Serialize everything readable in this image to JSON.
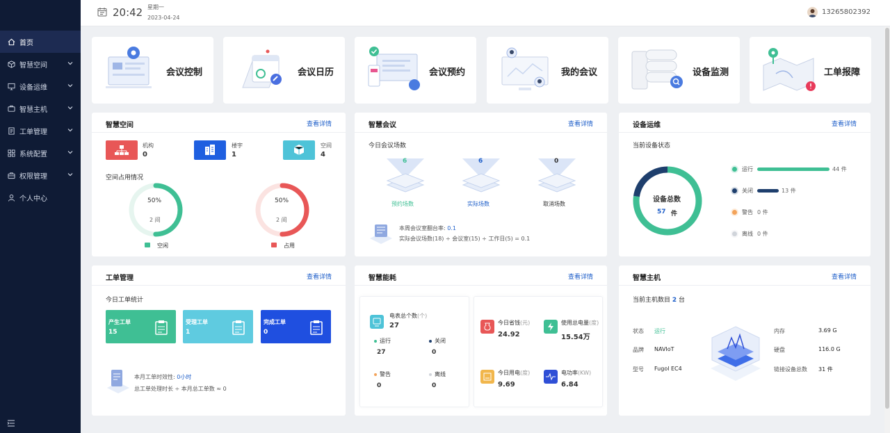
{
  "colors": {
    "sidebar": "#0f1b35",
    "accent": "#1f5fc9",
    "green": "#3fbf94",
    "red": "#e85757",
    "navy": "#1e3f6d",
    "orange": "#f3a35a"
  },
  "header": {
    "time": "20:42",
    "weekday": "星期一",
    "date": "2023-04-24",
    "user": "13265802392"
  },
  "sidebar": {
    "items": [
      {
        "label": "首页",
        "icon": "home-icon"
      },
      {
        "label": "智慧空间",
        "icon": "cube-icon"
      },
      {
        "label": "设备运维",
        "icon": "monitor-icon"
      },
      {
        "label": "智慧主机",
        "icon": "server-icon"
      },
      {
        "label": "工单管理",
        "icon": "document-icon"
      },
      {
        "label": "系统配置",
        "icon": "grid-icon"
      },
      {
        "label": "权限管理",
        "icon": "shield-icon"
      },
      {
        "label": "个人中心",
        "icon": "user-icon"
      }
    ]
  },
  "tiles": [
    {
      "label": "会议控制",
      "icon": "meeting-control-icon"
    },
    {
      "label": "会议日历",
      "icon": "calendar-icon"
    },
    {
      "label": "会议预约",
      "icon": "reservation-icon"
    },
    {
      "label": "我的会议",
      "icon": "my-meeting-icon"
    },
    {
      "label": "设备监测",
      "icon": "device-monitor-icon"
    },
    {
      "label": "工单报障",
      "icon": "fault-report-icon"
    }
  ],
  "more": "查看详情",
  "space": {
    "title": "智慧空间",
    "stats": [
      {
        "label": "机构",
        "value": "0"
      },
      {
        "label": "楼宇",
        "value": "1"
      },
      {
        "label": "空间",
        "value": "4"
      }
    ],
    "occupancy_title": "空间占用情况",
    "idle": {
      "percent": "50%",
      "count": "2 间",
      "label": "空闲",
      "fraction": 0.5
    },
    "occupied": {
      "percent": "50%",
      "count": "2 间",
      "label": "占用",
      "fraction": 0.5
    }
  },
  "meeting": {
    "title": "智慧会议",
    "subtitle": "今日会议场数",
    "cards": [
      {
        "value": "6",
        "label": "预约场数"
      },
      {
        "value": "6",
        "label": "实际场数"
      },
      {
        "value": "0",
        "label": "取消场数"
      }
    ],
    "rate_label": "本周会议室翻台率:",
    "rate_value": "0.1",
    "formula": "实际会议场数(18) ÷ 会议室(15) ÷ 工作日(5) = 0.1"
  },
  "device": {
    "title": "设备运维",
    "subtitle": "当前设备状态",
    "total_label": "设备总数",
    "total": "57",
    "unit": "件",
    "statuses": [
      {
        "label": "运行",
        "count": "44 件",
        "value": 44
      },
      {
        "label": "关闭",
        "count": "13 件",
        "value": 13
      },
      {
        "label": "警告",
        "count": "0 件",
        "value": 0
      },
      {
        "label": "离线",
        "count": "0 件",
        "value": 0
      }
    ]
  },
  "workorder": {
    "title": "工单管理",
    "subtitle": "今日工单统计",
    "cards": [
      {
        "label": "产生工单",
        "value": "15"
      },
      {
        "label": "受理工单",
        "value": "1"
      },
      {
        "label": "完成工单",
        "value": "0"
      }
    ],
    "eff_label": "本月工单时效性:",
    "eff_value": "0小时",
    "formula": "总工单处理时长 ÷ 本月总工单数 ≈ 0"
  },
  "energy": {
    "title": "智慧能耗",
    "meters_label": "电表总个数",
    "meters_unit": "(个)",
    "meters_value": "27",
    "status": [
      {
        "label": "运行",
        "value": "27"
      },
      {
        "label": "关闭",
        "value": "0"
      },
      {
        "label": "警告",
        "value": "0"
      },
      {
        "label": "离线",
        "value": "0"
      }
    ],
    "metrics": [
      {
        "label": "今日省钱",
        "unit": "(元)",
        "value": "24.92"
      },
      {
        "label": "使用总电量",
        "unit": "(度)",
        "value": "15.54万"
      },
      {
        "label": "今日用电",
        "unit": "(度)",
        "value": "9.69"
      },
      {
        "label": "电功率",
        "unit": "(KW)",
        "value": "6.84"
      }
    ]
  },
  "host": {
    "title": "智慧主机",
    "count_label": "当前主机数目",
    "count_value": "2",
    "count_unit": "台",
    "left": [
      {
        "label": "状态",
        "value": "运行"
      },
      {
        "label": "品牌",
        "value": "NAVIoT"
      },
      {
        "label": "型号",
        "value": "Fugol EC4"
      }
    ],
    "right": [
      {
        "label": "内存",
        "value": "3.69  G"
      },
      {
        "label": "硬盘",
        "value": "116.0  G"
      },
      {
        "label": "链接设备总数",
        "value": "31 件"
      }
    ]
  }
}
